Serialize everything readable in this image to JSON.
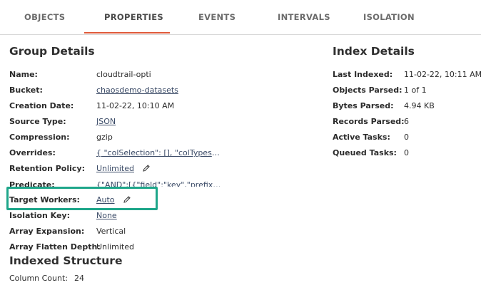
{
  "tabs": [
    {
      "label": "OBJECTS"
    },
    {
      "label": "PROPERTIES"
    },
    {
      "label": "EVENTS"
    },
    {
      "label": "INTERVALS"
    },
    {
      "label": "ISOLATION"
    }
  ],
  "active_tab": "PROPERTIES",
  "colors": {
    "accent": "#e05a3a",
    "highlight": "#1ea68a"
  },
  "group_details": {
    "title": "Group Details",
    "rows": [
      {
        "label": "Name:",
        "value": "cloudtrail-opti"
      },
      {
        "label": "Bucket:",
        "value": "chaosdemo-datasets"
      },
      {
        "label": "Creation Date:",
        "value": "11-02-22, 10:10 AM"
      },
      {
        "label": "Source Type:",
        "value": "JSON"
      },
      {
        "label": "Compression:",
        "value": "gzip"
      },
      {
        "label": "Overrides:",
        "value": "{ \"colSelection\": [], \"colTypes\": {..."
      },
      {
        "label": "Retention Policy:",
        "value": "Unlimited"
      },
      {
        "label": "Predicate:",
        "value": "{\"AND\":[{\"field\":\"key\",\"prefix\":\"clo..."
      },
      {
        "label": "Target Workers:",
        "value": "Auto"
      },
      {
        "label": "Isolation Key:",
        "value": "None"
      },
      {
        "label": "Array Expansion:",
        "value": "Vertical"
      },
      {
        "label": "Array Flatten Depth:",
        "value": "Unlimited"
      }
    ]
  },
  "index_details": {
    "title": "Index Details",
    "rows": [
      {
        "label": "Last Indexed:",
        "value": "11-02-22, 10:11 AM"
      },
      {
        "label": "Objects Parsed:",
        "value": "1 of 1"
      },
      {
        "label": "Bytes Parsed:",
        "value": "4.94 KB"
      },
      {
        "label": "Records Parsed:",
        "value": "6"
      },
      {
        "label": "Active Tasks:",
        "value": "0"
      },
      {
        "label": "Queued Tasks:",
        "value": "0"
      }
    ]
  },
  "indexed_structure": {
    "title": "Indexed Structure",
    "column_count_label": "Column Count:",
    "column_count": "24"
  }
}
